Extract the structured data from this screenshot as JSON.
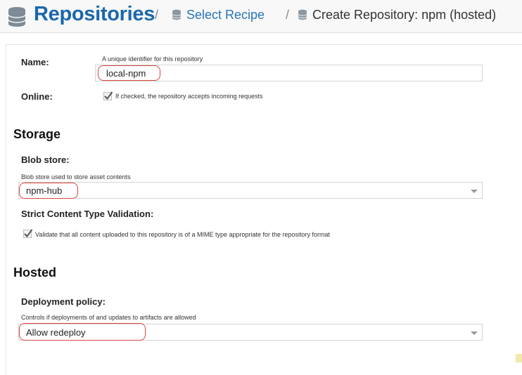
{
  "header": {
    "title": "Repositories",
    "separator": "/",
    "select_recipe": "Select Recipe",
    "current": "Create Repository: npm (hosted)"
  },
  "form": {
    "name": {
      "label": "Name:",
      "help": "A unique identifier for this repository",
      "value": "local-npm"
    },
    "online": {
      "label": "Online:",
      "checked": true,
      "help": "If checked, the repository accepts incoming requests"
    }
  },
  "storage": {
    "title": "Storage",
    "blob_store": {
      "label": "Blob store:",
      "help": "Blob store used to store asset contents",
      "value": "npm-hub"
    },
    "strict": {
      "label": "Strict Content Type Validation:",
      "checked": true,
      "help": "Validate that all content uploaded to this repository is of a MIME type appropriate for the repository format"
    }
  },
  "hosted": {
    "title": "Hosted",
    "deployment": {
      "label": "Deployment policy:",
      "help": "Controls if deployments of and updates to artifacts are allowed",
      "value": "Allow redeploy"
    }
  },
  "colors": {
    "brand": "#1a67ad",
    "link": "#2a74b8",
    "highlight": "#d9473c"
  },
  "icons": [
    "database-icon",
    "database-icon-small",
    "checkbox-checked-icon",
    "dropdown-caret-icon"
  ]
}
